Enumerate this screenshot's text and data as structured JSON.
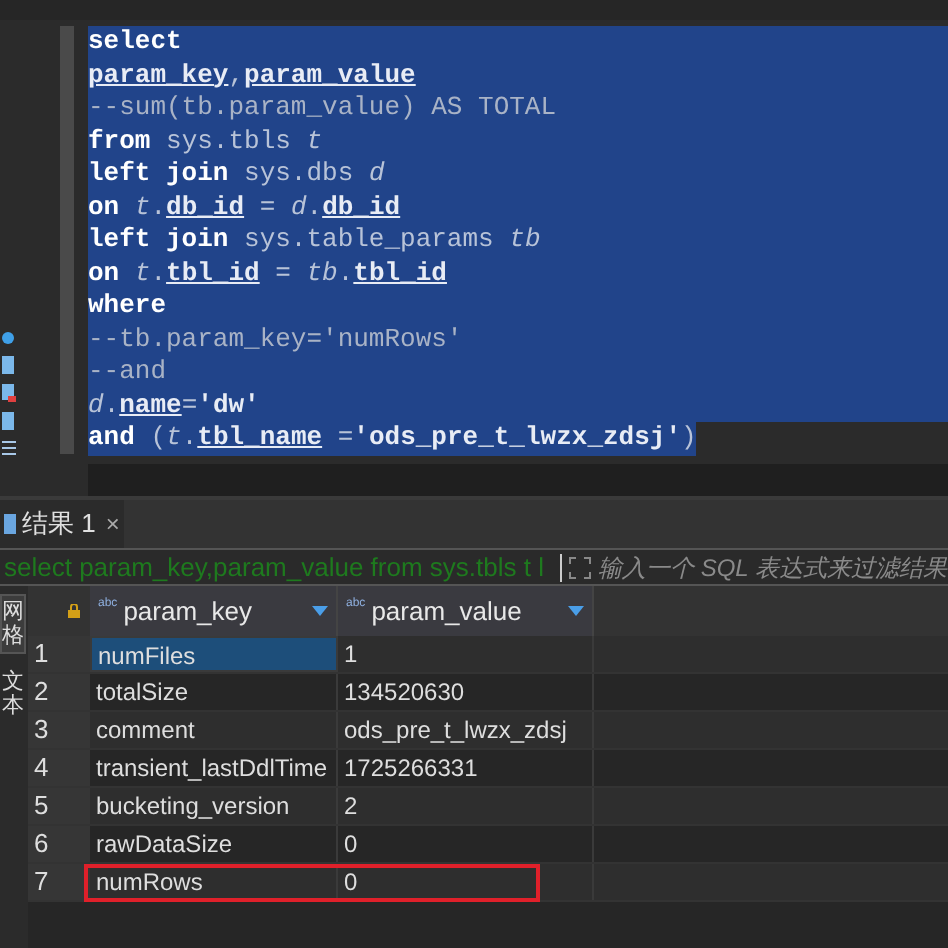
{
  "editor": {
    "lines": [
      [
        {
          "kind": "kw",
          "text": "select"
        }
      ],
      [
        {
          "kind": "col",
          "text": "param_key"
        },
        {
          "kind": "plain",
          "text": ","
        },
        {
          "kind": "col",
          "text": "param_value"
        }
      ],
      [
        {
          "kind": "comment",
          "text": "--sum(tb.param_value) AS TOTAL"
        }
      ],
      [
        {
          "kind": "kw",
          "text": "from"
        },
        {
          "kind": "plain",
          "text": " sys.tbls "
        },
        {
          "kind": "alias",
          "text": "t"
        }
      ],
      [
        {
          "kind": "kw",
          "text": "left join"
        },
        {
          "kind": "plain",
          "text": " sys.dbs "
        },
        {
          "kind": "alias",
          "text": "d"
        }
      ],
      [
        {
          "kind": "kw",
          "text": "on"
        },
        {
          "kind": "alias",
          "text": " t"
        },
        {
          "kind": "plain",
          "text": "."
        },
        {
          "kind": "col",
          "text": "db_id"
        },
        {
          "kind": "plain",
          "text": " = "
        },
        {
          "kind": "alias",
          "text": "d"
        },
        {
          "kind": "plain",
          "text": "."
        },
        {
          "kind": "col",
          "text": "db_id"
        }
      ],
      [
        {
          "kind": "kw",
          "text": "left join"
        },
        {
          "kind": "plain",
          "text": " sys.table_params "
        },
        {
          "kind": "alias",
          "text": "tb"
        }
      ],
      [
        {
          "kind": "kw",
          "text": "on"
        },
        {
          "kind": "alias",
          "text": " t"
        },
        {
          "kind": "plain",
          "text": "."
        },
        {
          "kind": "col",
          "text": "tbl_id"
        },
        {
          "kind": "plain",
          "text": " = "
        },
        {
          "kind": "alias",
          "text": "tb"
        },
        {
          "kind": "plain",
          "text": "."
        },
        {
          "kind": "col",
          "text": "tbl_id"
        }
      ],
      [
        {
          "kind": "kw",
          "text": "where"
        }
      ],
      [
        {
          "kind": "comment",
          "text": "--tb.param_key='numRows'"
        }
      ],
      [
        {
          "kind": "comment",
          "text": "--and"
        }
      ],
      [
        {
          "kind": "alias",
          "text": "d"
        },
        {
          "kind": "plain",
          "text": "."
        },
        {
          "kind": "col",
          "text": "name"
        },
        {
          "kind": "plain",
          "text": "="
        },
        {
          "kind": "str",
          "text": "'dw'"
        }
      ],
      [
        {
          "kind": "kw",
          "text": "and"
        },
        {
          "kind": "plain",
          "text": " ("
        },
        {
          "kind": "alias",
          "text": "t"
        },
        {
          "kind": "plain",
          "text": "."
        },
        {
          "kind": "col",
          "text": "tbl_name"
        },
        {
          "kind": "plain",
          "text": " ="
        },
        {
          "kind": "str",
          "text": "'ods_pre_t_lwzx_zdsj'"
        },
        {
          "kind": "plain",
          "text": ")"
        }
      ]
    ]
  },
  "results": {
    "tab": {
      "label": "结果 1",
      "close": "×"
    },
    "filter": {
      "query": "select param_key,param_value from sys.tbls t l",
      "placeholder": "输入一个 SQL 表达式来过滤结果"
    },
    "side_tabs": [
      {
        "label": "网格",
        "selected": true
      },
      {
        "label": "文本",
        "selected": false
      }
    ],
    "columns": [
      {
        "name": "param_key",
        "type": "abc"
      },
      {
        "name": "param_value",
        "type": "abc"
      }
    ],
    "rows": [
      {
        "num": "1",
        "cells": [
          "numFiles",
          "1"
        ],
        "selected": true,
        "highlighted": false
      },
      {
        "num": "2",
        "cells": [
          "totalSize",
          "134520630"
        ],
        "selected": false,
        "highlighted": false
      },
      {
        "num": "3",
        "cells": [
          "comment",
          "ods_pre_t_lwzx_zdsj"
        ],
        "selected": false,
        "highlighted": false
      },
      {
        "num": "4",
        "cells": [
          "transient_lastDdlTime",
          "1725266331"
        ],
        "selected": false,
        "highlighted": false
      },
      {
        "num": "5",
        "cells": [
          "bucketing_version",
          "2"
        ],
        "selected": false,
        "highlighted": false
      },
      {
        "num": "6",
        "cells": [
          "rawDataSize",
          "0"
        ],
        "selected": false,
        "highlighted": false
      },
      {
        "num": "7",
        "cells": [
          "numRows",
          "0"
        ],
        "selected": false,
        "highlighted": true
      }
    ]
  }
}
